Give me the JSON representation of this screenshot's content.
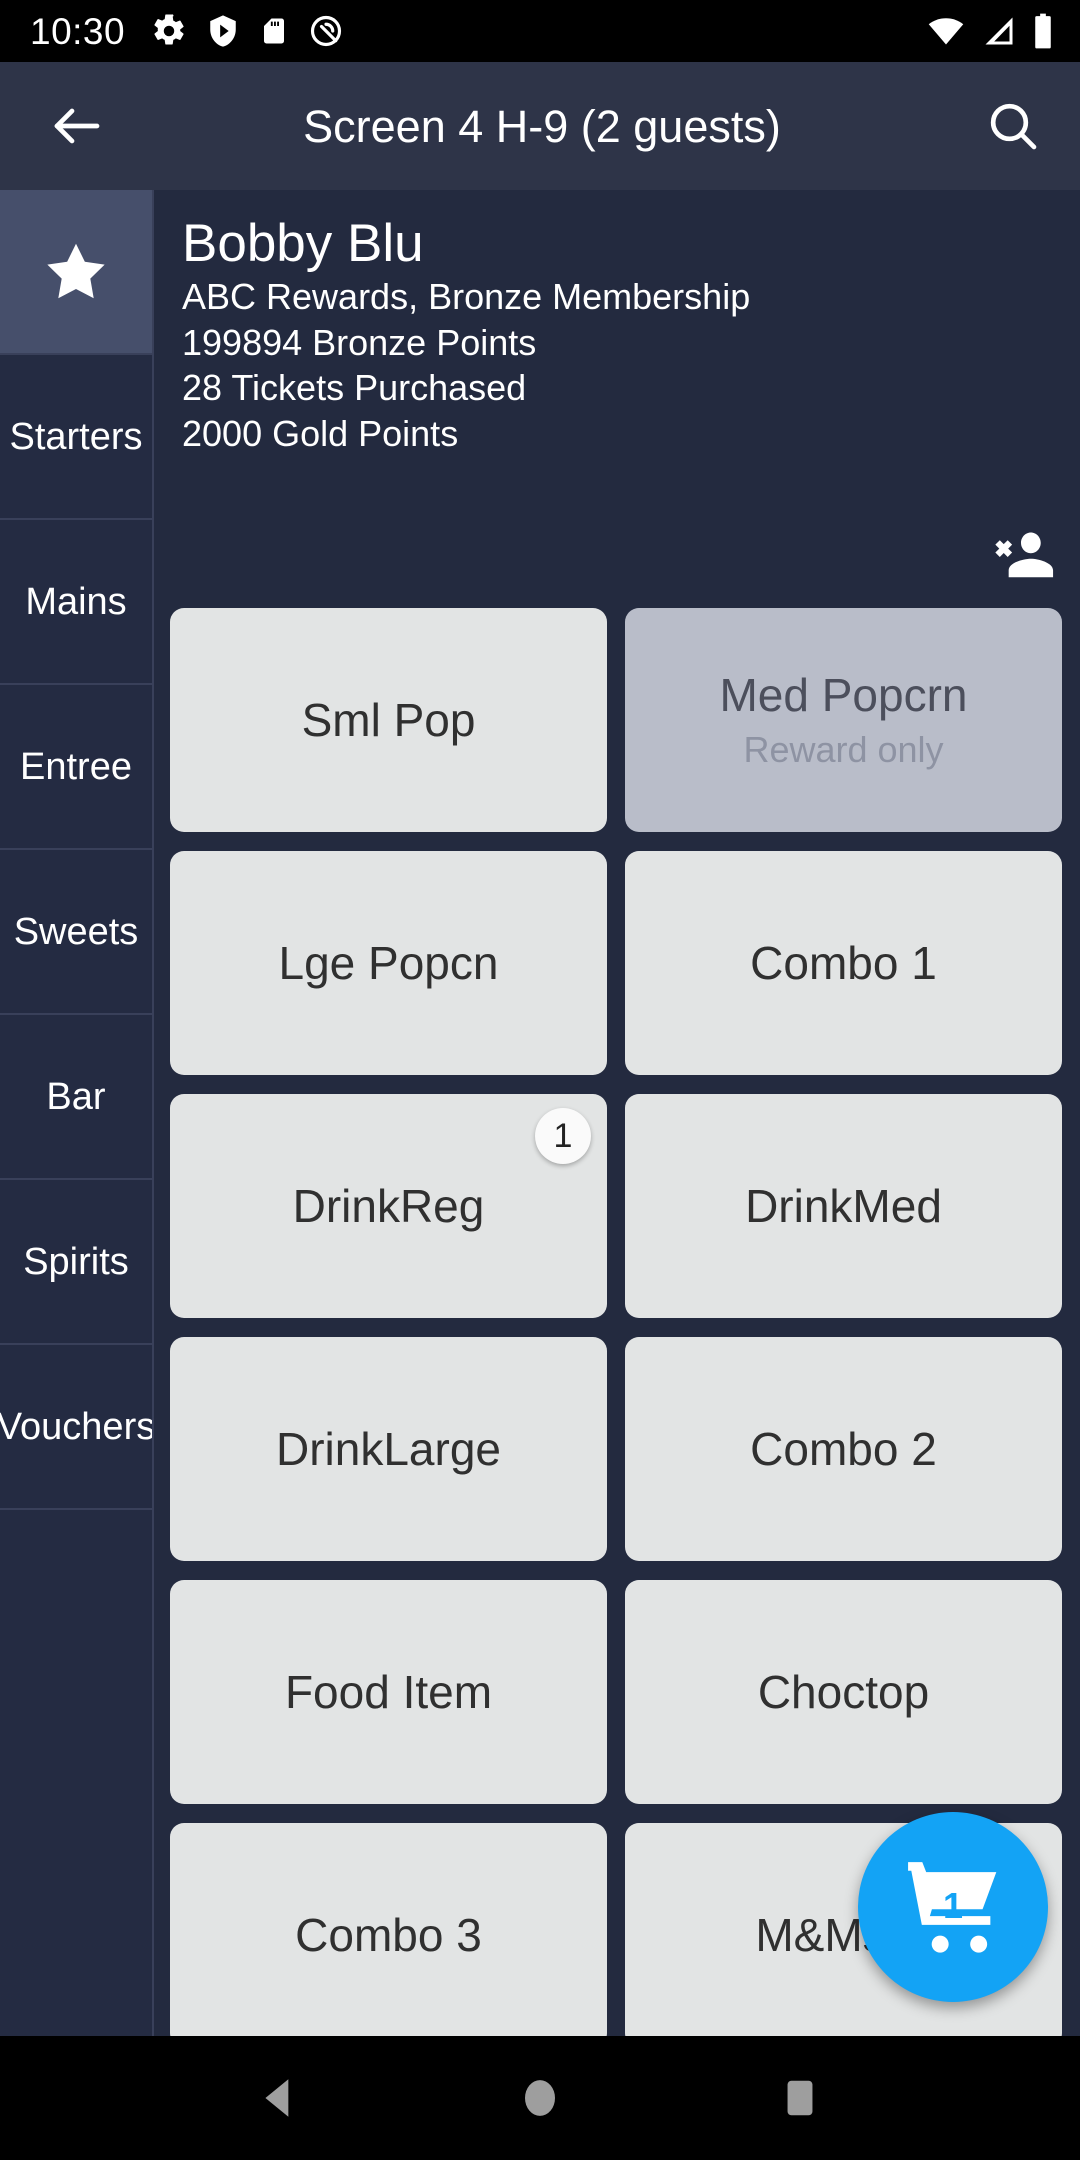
{
  "status_bar": {
    "time": "10:30",
    "left_icons": [
      "settings-gear-icon",
      "shield-play-icon",
      "sd-card-icon",
      "circle-slash-icon"
    ],
    "right_icons": [
      "wifi-icon",
      "cell-signal-icon",
      "battery-full-icon"
    ]
  },
  "app_bar": {
    "back_icon": "back-arrow-icon",
    "title": "Screen 4 H-9 (2 guests)",
    "search_icon": "search-icon"
  },
  "sidebar": {
    "items": [
      {
        "label": "",
        "icon": "star-icon",
        "selected": true
      },
      {
        "label": "Starters",
        "selected": false
      },
      {
        "label": "Mains",
        "selected": false
      },
      {
        "label": "Entree",
        "selected": false
      },
      {
        "label": "Sweets",
        "selected": false
      },
      {
        "label": "Bar",
        "selected": false
      },
      {
        "label": "Spirits",
        "selected": false
      },
      {
        "label": "Vouchers",
        "selected": false
      }
    ]
  },
  "customer": {
    "name": "Bobby Blu",
    "membership": "ABC Rewards, Bronze Membership",
    "bronze_points": "199894 Bronze  Points",
    "tickets": "28 Tickets Purchased",
    "gold_points": "2000 Gold Points",
    "remove_icon": "person-remove-icon"
  },
  "products": [
    [
      {
        "label": "Sml Pop",
        "sub": "",
        "reward_only": false,
        "qty": ""
      },
      {
        "label": "Med Popcrn",
        "sub": "Reward only",
        "reward_only": true,
        "qty": ""
      }
    ],
    [
      {
        "label": "Lge Popcn",
        "sub": "",
        "reward_only": false,
        "qty": ""
      },
      {
        "label": "Combo 1",
        "sub": "",
        "reward_only": false,
        "qty": ""
      }
    ],
    [
      {
        "label": "DrinkReg",
        "sub": "",
        "reward_only": false,
        "qty": "1"
      },
      {
        "label": "DrinkMed",
        "sub": "",
        "reward_only": false,
        "qty": ""
      }
    ],
    [
      {
        "label": "DrinkLarge",
        "sub": "",
        "reward_only": false,
        "qty": ""
      },
      {
        "label": "Combo 2",
        "sub": "",
        "reward_only": false,
        "qty": ""
      }
    ],
    [
      {
        "label": "Food Item",
        "sub": "",
        "reward_only": false,
        "qty": ""
      },
      {
        "label": "Choctop",
        "sub": "",
        "reward_only": false,
        "qty": ""
      }
    ],
    [
      {
        "label": "Combo 3",
        "sub": "",
        "reward_only": false,
        "qty": ""
      },
      {
        "label": "M&Ms H",
        "sub": "",
        "reward_only": false,
        "qty": ""
      }
    ]
  ],
  "cart": {
    "icon": "shopping-cart-icon",
    "count": "1"
  },
  "nav_bar": {
    "back": "nav-back-icon",
    "home": "nav-home-icon",
    "recents": "nav-recents-icon"
  },
  "colors": {
    "accent_blue": "#13a3f5",
    "app_bar": "#2e3448",
    "body": "#232a3f",
    "sidebar": "#242b42",
    "sidebar_selected": "#464f6b",
    "product": "#e2e4e4",
    "product_reward": "#b9bdc9"
  }
}
